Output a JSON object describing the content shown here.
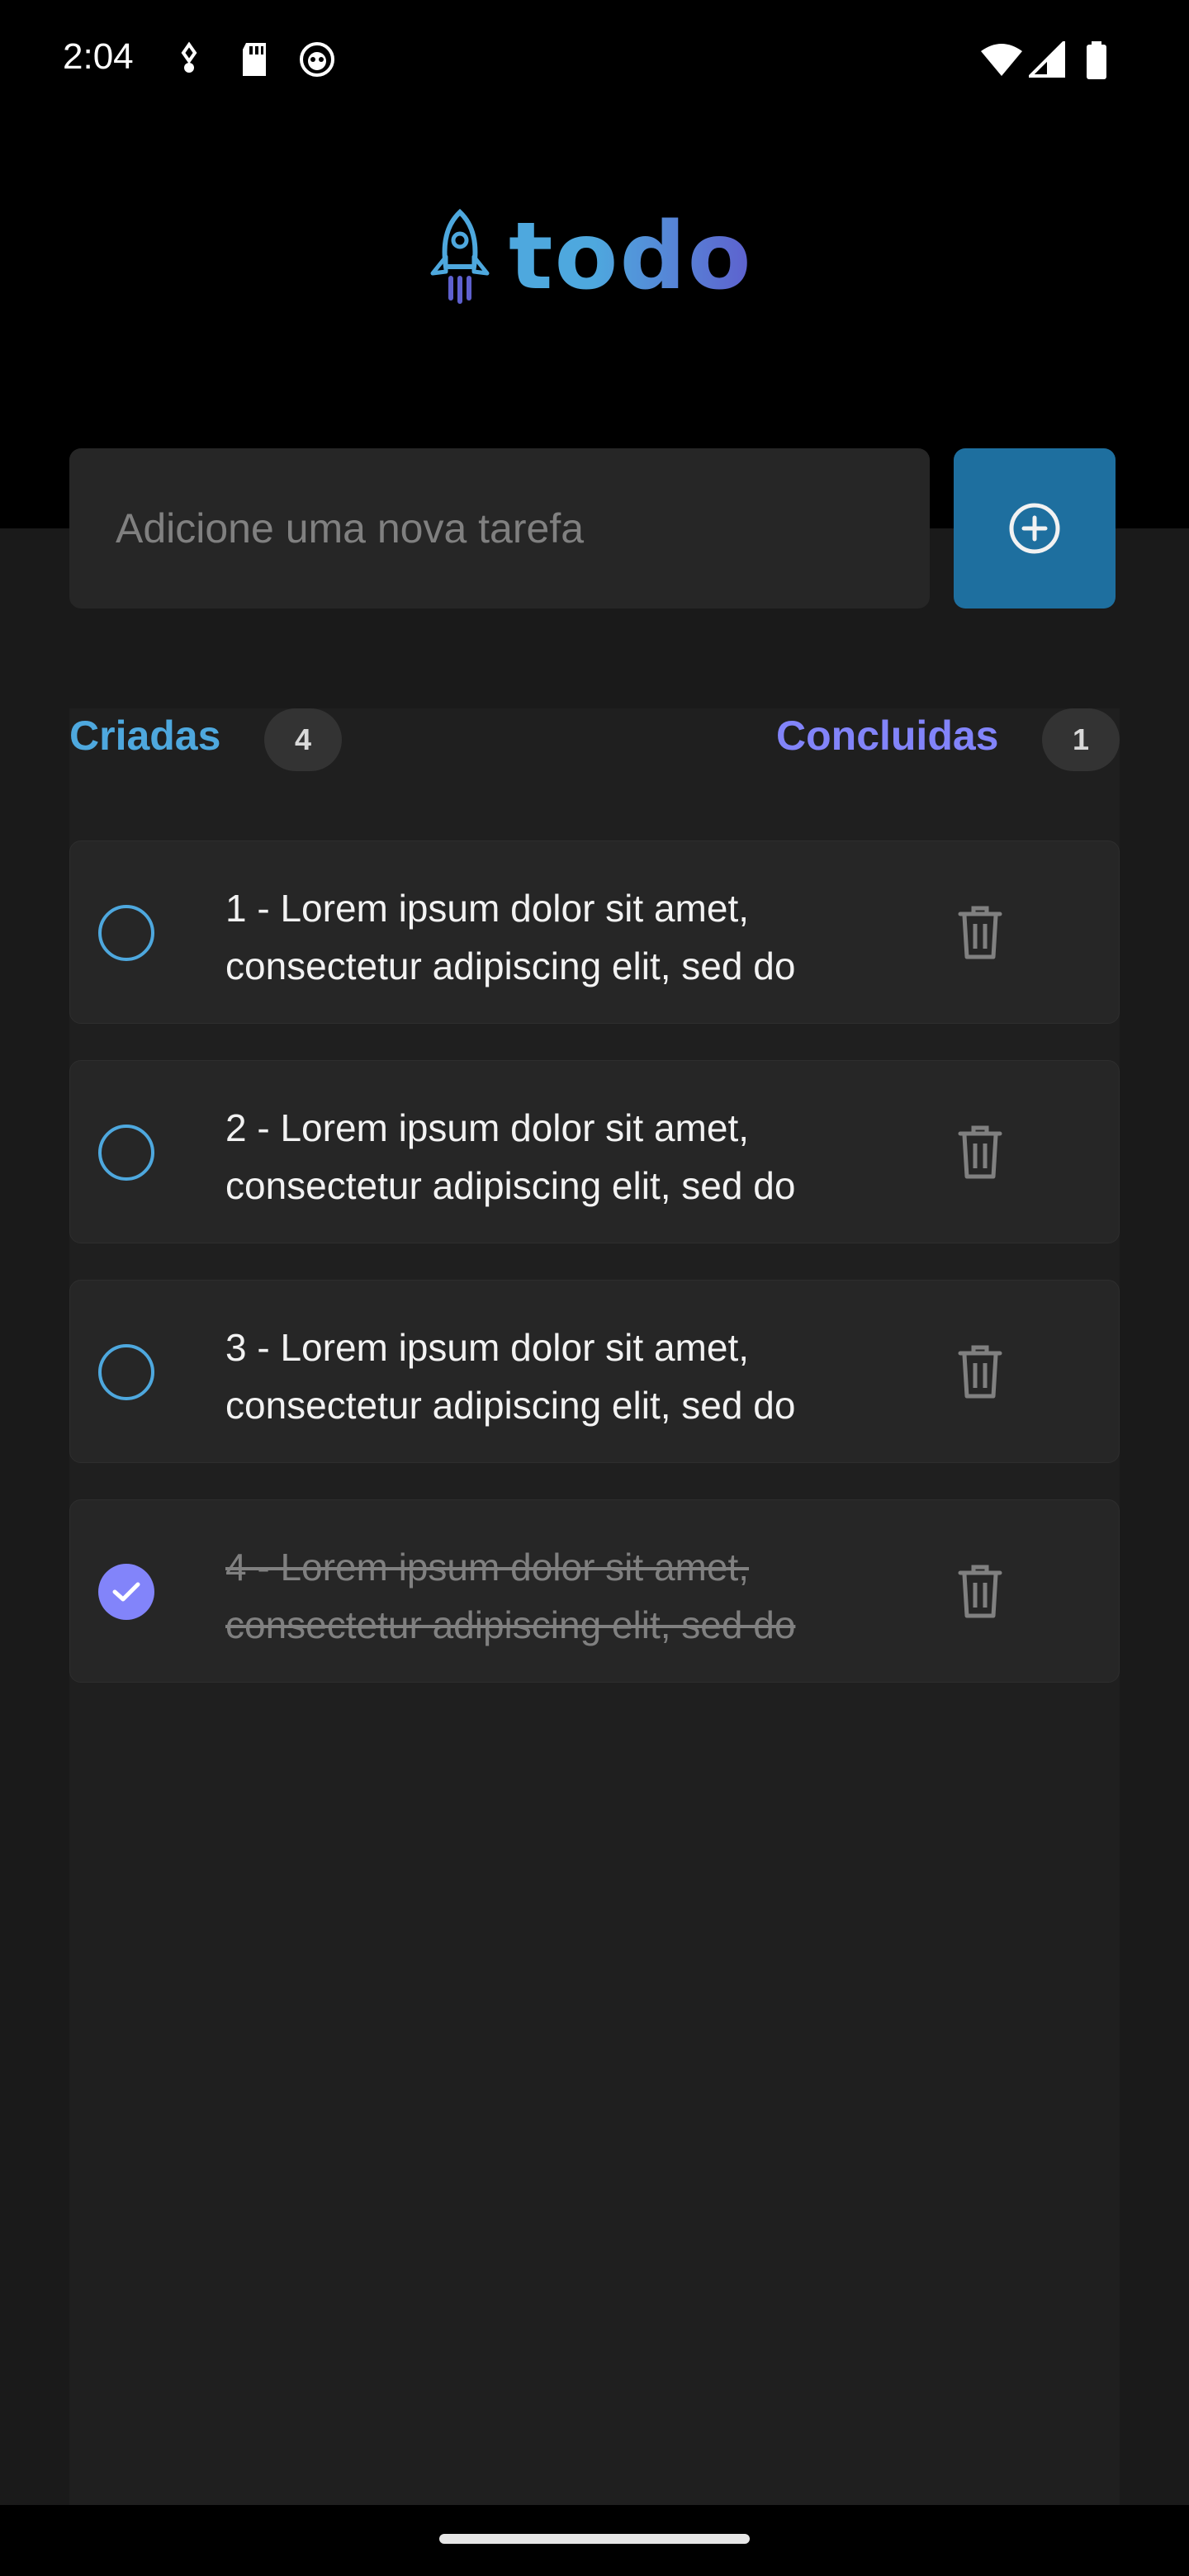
{
  "status_bar": {
    "time": "2:04"
  },
  "header": {
    "logo_text": "todo"
  },
  "new_task": {
    "placeholder": "Adicione uma nova tarefa"
  },
  "counters": {
    "created_label": "Criadas",
    "created_count": "4",
    "done_label": "Concluidas",
    "done_count": "1"
  },
  "tasks": [
    {
      "text": "1 - Lorem ipsum dolor sit amet, consectetur adipiscing elit, sed do",
      "done": false
    },
    {
      "text": "2 - Lorem ipsum dolor sit amet, consectetur adipiscing elit, sed do",
      "done": false
    },
    {
      "text": "3 - Lorem ipsum dolor sit amet, consectetur adipiscing elit, sed do",
      "done": false
    },
    {
      "text": "4 - Lorem ipsum dolor sit amet, consectetur adipiscing elit, sed do",
      "done": true
    }
  ],
  "colors": {
    "accent_blue": "#4ea8de",
    "accent_purple": "#8284fa",
    "button_blue": "#1e6f9f",
    "background": "#1a1a1a",
    "card": "#262626"
  }
}
